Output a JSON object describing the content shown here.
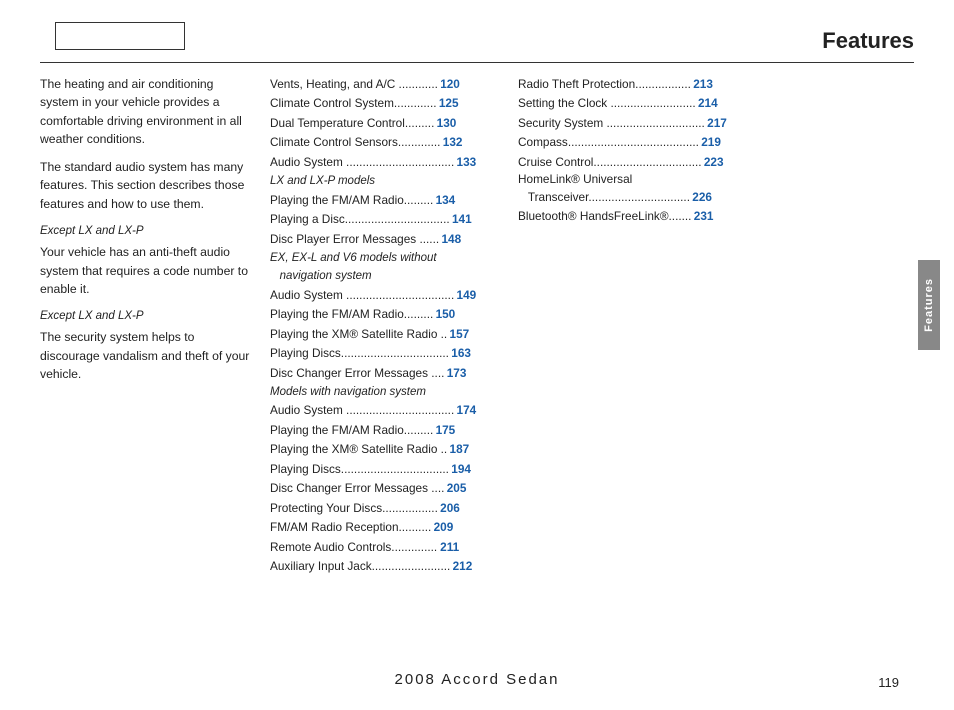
{
  "page": {
    "title": "Features",
    "page_number": "119",
    "footer_title": "2008  Accord  Sedan"
  },
  "left_column": {
    "paragraphs": [
      "The heating and air conditioning system in your vehicle provides a comfortable driving environment in all weather conditions.",
      "The standard audio system has many features. This section describes those features and how to use them."
    ],
    "sections": [
      {
        "label": "Except LX and LX-P",
        "text": "Your vehicle has an anti-theft audio system that requires a code number to enable it."
      },
      {
        "label": "Except LX and LX-P",
        "text": "The security system helps to discourage vandalism and theft of your vehicle."
      }
    ]
  },
  "middle_column": {
    "entries": [
      {
        "label": "Vents, Heating, and A/C ",
        "dots": ".............",
        "page": "120"
      },
      {
        "label": "Climate Control System",
        "dots": ".............",
        "page": "125"
      },
      {
        "label": "Dual Temperature Control",
        "dots": ".........",
        "page": "130"
      },
      {
        "label": "Climate Control Sensors",
        "dots": ".............",
        "page": "132"
      },
      {
        "label": "Audio System ",
        "dots": ".................................",
        "page": "133"
      },
      {
        "section": "LX and LX-P models"
      },
      {
        "label": "Playing the FM/AM Radio",
        "dots": ".........",
        "page": "134"
      },
      {
        "label": "Playing a Disc",
        "dots": "................................",
        "page": "141"
      },
      {
        "label": "Disc Player Error Messages ",
        "dots": ".......",
        "page": "148"
      },
      {
        "section": "EX, EX-L and V6 models without navigation system"
      },
      {
        "label": "Audio System ",
        "dots": ".................................",
        "page": "149"
      },
      {
        "label": "Playing the FM/AM Radio",
        "dots": ".........",
        "page": "150"
      },
      {
        "label": "Playing the XM® Satellite Radio ",
        "dots": "..",
        "page": "157"
      },
      {
        "label": "Playing Discs",
        "dots": "................................",
        "page": "163"
      },
      {
        "label": "Disc Changer Error Messages ",
        "dots": "....",
        "page": "173"
      },
      {
        "section": "Models with navigation system"
      },
      {
        "label": "Audio System ",
        "dots": ".................................",
        "page": "174"
      },
      {
        "label": "Playing the FM/AM Radio",
        "dots": ".........",
        "page": "175"
      },
      {
        "label": "Playing the XM® Satellite Radio ",
        "dots": "..",
        "page": "187"
      },
      {
        "label": "Playing Discs",
        "dots": "................................",
        "page": "194"
      },
      {
        "label": "Disc Changer Error Messages ",
        "dots": "....",
        "page": "205"
      },
      {
        "label": "Protecting Your Discs",
        "dots": ".................",
        "page": "206"
      },
      {
        "label": "FM/AM Radio Reception",
        "dots": "..........",
        "page": "209"
      },
      {
        "label": "Remote Audio Controls",
        "dots": "..............",
        "page": "211"
      },
      {
        "label": "Auxiliary Input Jack",
        "dots": "........................",
        "page": "212"
      }
    ]
  },
  "right_column": {
    "entries": [
      {
        "label": "Radio Theft Protection",
        "dots": ".................",
        "page": "213"
      },
      {
        "label": "Setting the Clock ",
        "dots": "............................",
        "page": "214"
      },
      {
        "label": "Security System ",
        "dots": "..............................",
        "page": "217"
      },
      {
        "label": "Compass",
        "dots": "........................................",
        "page": "219"
      },
      {
        "label": "Cruise Control",
        "dots": ".................................",
        "page": "223"
      },
      {
        "label": "HomeLink® Universal",
        "dots": "",
        "page": ""
      },
      {
        "label": "   Transceiver",
        "dots": "...............................",
        "page": "226"
      },
      {
        "label": "Bluetooth® HandsFreeLink®",
        "dots": ".......",
        "page": "231"
      }
    ]
  },
  "side_tab": {
    "text": "Features"
  }
}
